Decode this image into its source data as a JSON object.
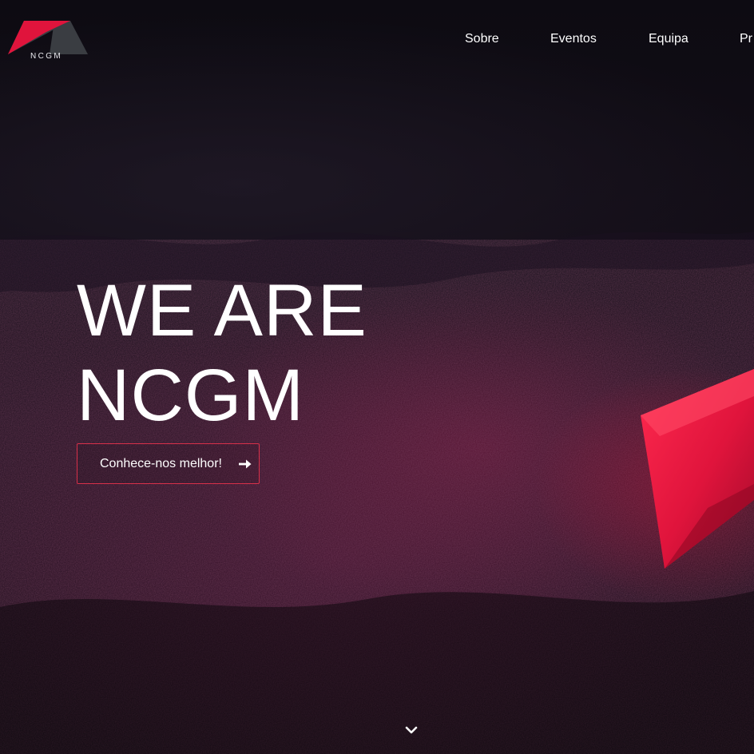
{
  "brand": {
    "logo_text": "NCGM",
    "colors": {
      "accent": "#e0143c",
      "logo_red": "#e0143c",
      "logo_gray": "#3a3d42"
    }
  },
  "nav": {
    "items": [
      {
        "label": "Sobre"
      },
      {
        "label": "Eventos"
      },
      {
        "label": "Equipa"
      },
      {
        "label": "Pr"
      }
    ]
  },
  "hero": {
    "headline_line1": "WE ARE",
    "headline_line2": "NCGM",
    "cta_label": "Conhece-nos melhor!",
    "cta_icon": "arrow-right-icon",
    "scroll_icon": "chevron-down-icon"
  }
}
